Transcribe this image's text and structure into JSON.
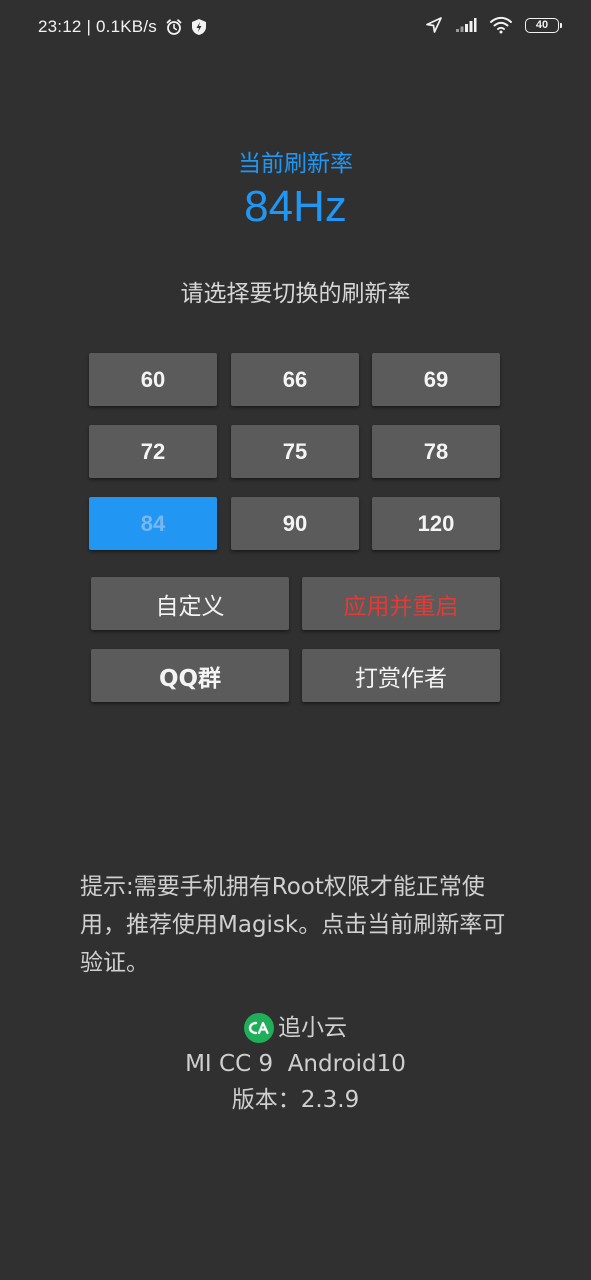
{
  "status_bar": {
    "time": "23:12",
    "separator": " | ",
    "speed": "0.1KB/s",
    "battery": "40",
    "icons": [
      "alarm-icon",
      "shield-bolt-icon",
      "location-arrow-icon",
      "signal-icon",
      "wifi-icon",
      "battery-icon"
    ]
  },
  "header": {
    "current_label": "当前刷新率",
    "current_value": "84Hz",
    "select_label": "请选择要切换的刷新率"
  },
  "rates": [
    "60",
    "66",
    "69",
    "72",
    "75",
    "78",
    "84",
    "90",
    "120"
  ],
  "selected_rate": "84",
  "actions": {
    "custom": "自定义",
    "apply_restart": "应用并重启",
    "qq_group": "QQ群",
    "donate": "打赏作者"
  },
  "tip": "提示:需要手机拥有Root权限才能正常使用，推荐使用Magisk。点击当前刷新率可验证。",
  "footer": {
    "brand": "追小云",
    "device": "MI CC 9  Android10",
    "version": "版本：2.3.9"
  },
  "colors": {
    "background": "#303030",
    "accent": "#2196f3",
    "button": "#5b5b5b",
    "danger": "#e53935",
    "brand_green": "#1fae5a"
  }
}
